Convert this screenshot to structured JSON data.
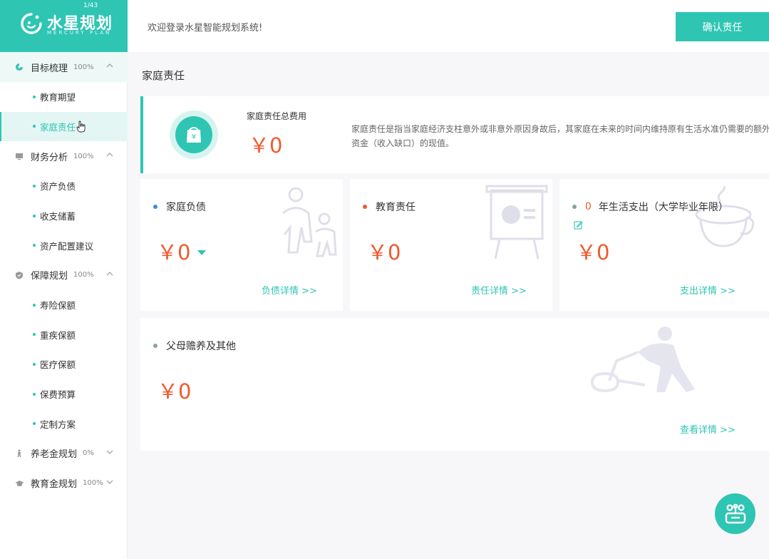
{
  "logo": {
    "counter": "1/43",
    "brand": "水星规划",
    "sub": "MERCURY PLAN"
  },
  "header": {
    "welcome": "欢迎登录水星智能规划系统!",
    "confirm_label": "确认责任"
  },
  "sidebar": {
    "groups": [
      {
        "label": "目标梳理",
        "pct": "100%",
        "icon": "target-icon",
        "items": [
          {
            "label": "教育期望"
          },
          {
            "label": "家庭责任",
            "active": true
          }
        ]
      },
      {
        "label": "财务分析",
        "pct": "100%",
        "icon": "monitor-icon",
        "items": [
          {
            "label": "资产负债"
          },
          {
            "label": "收支储蓄"
          },
          {
            "label": "资产配置建议"
          }
        ]
      },
      {
        "label": "保障规划",
        "pct": "100%",
        "icon": "shield-icon",
        "items": [
          {
            "label": "寿险保额"
          },
          {
            "label": "重疾保额"
          },
          {
            "label": "医疗保额"
          },
          {
            "label": "保费预算"
          },
          {
            "label": "定制方案"
          }
        ]
      },
      {
        "label": "养老金规划",
        "pct": "0%",
        "icon": "person-icon",
        "items": []
      },
      {
        "label": "教育金规划",
        "pct": "100%",
        "icon": "graduation-cap-icon",
        "items": []
      }
    ]
  },
  "main": {
    "title": "家庭责任",
    "summary": {
      "label": "家庭责任总费用",
      "amount": "￥0",
      "desc": "家庭责任是指当家庭经济支柱意外或非意外原因身故后，其家庭在未来的时间内维持原有生活水准仍需要的额外资金（收入缺口）的现值。"
    },
    "cards": {
      "debt": {
        "title": "家庭负债",
        "value": "￥0",
        "link": "负债详情 >>",
        "color": "#3a8fd6"
      },
      "education": {
        "title": "教育责任",
        "value": "￥0",
        "link": "责任详情 >>",
        "color": "#f05a2b"
      },
      "living": {
        "years": "0",
        "title": "年生活支出（大学毕业年限）",
        "value": "￥0",
        "link": "支出详情 >>",
        "color": "#8aa58f"
      },
      "parents": {
        "title": "父母赡养及其他",
        "value": "￥0",
        "link": "查看详情 >>",
        "color": "#8aa58f"
      }
    }
  },
  "colors": {
    "accent": "#2ec5b3",
    "amount": "#f05a2b"
  }
}
